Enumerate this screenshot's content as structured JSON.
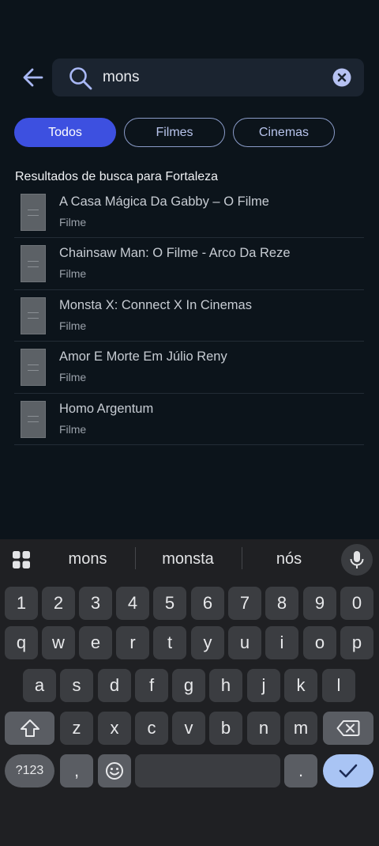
{
  "search": {
    "value": "mons",
    "back_icon": "arrow-left-icon",
    "search_icon": "magnifier-icon",
    "clear_icon": "clear-circle-icon"
  },
  "filters": [
    {
      "label": "Todos",
      "active": true
    },
    {
      "label": "Filmes",
      "active": false
    },
    {
      "label": "Cinemas",
      "active": false
    }
  ],
  "results_heading": "Resultados de busca para Fortaleza",
  "results": [
    {
      "title": "A Casa Mágica Da Gabby – O Filme",
      "type": "Filme"
    },
    {
      "title": "Chainsaw Man: O Filme - Arco Da Reze",
      "type": "Filme"
    },
    {
      "title": "Monsta X: Connect X In Cinemas",
      "type": "Filme"
    },
    {
      "title": "Amor E Morte Em Júlio Reny",
      "type": "Filme"
    },
    {
      "title": "Homo Argentum",
      "type": "Filme"
    }
  ],
  "keyboard": {
    "suggestions": [
      "mons",
      "monsta",
      "nós"
    ],
    "row_numbers": [
      "1",
      "2",
      "3",
      "4",
      "5",
      "6",
      "7",
      "8",
      "9",
      "0"
    ],
    "row_1": [
      "q",
      "w",
      "e",
      "r",
      "t",
      "y",
      "u",
      "i",
      "o",
      "p"
    ],
    "row_2": [
      "a",
      "s",
      "d",
      "f",
      "g",
      "h",
      "j",
      "k",
      "l"
    ],
    "row_3": [
      "z",
      "x",
      "c",
      "v",
      "b",
      "n",
      "m"
    ],
    "symbols_label": "?123",
    "comma": ",",
    "period": ".",
    "icons": {
      "grid": "app-grid-icon",
      "mic": "microphone-icon",
      "shift": "shift-icon",
      "backspace": "backspace-icon",
      "emoji": "emoji-icon",
      "enter": "checkmark-icon"
    }
  },
  "colors": {
    "background": "#0c141b",
    "accent": "#3d50e0",
    "keyboard_bg": "#1f2023",
    "enter_key": "#a9c4f4"
  }
}
